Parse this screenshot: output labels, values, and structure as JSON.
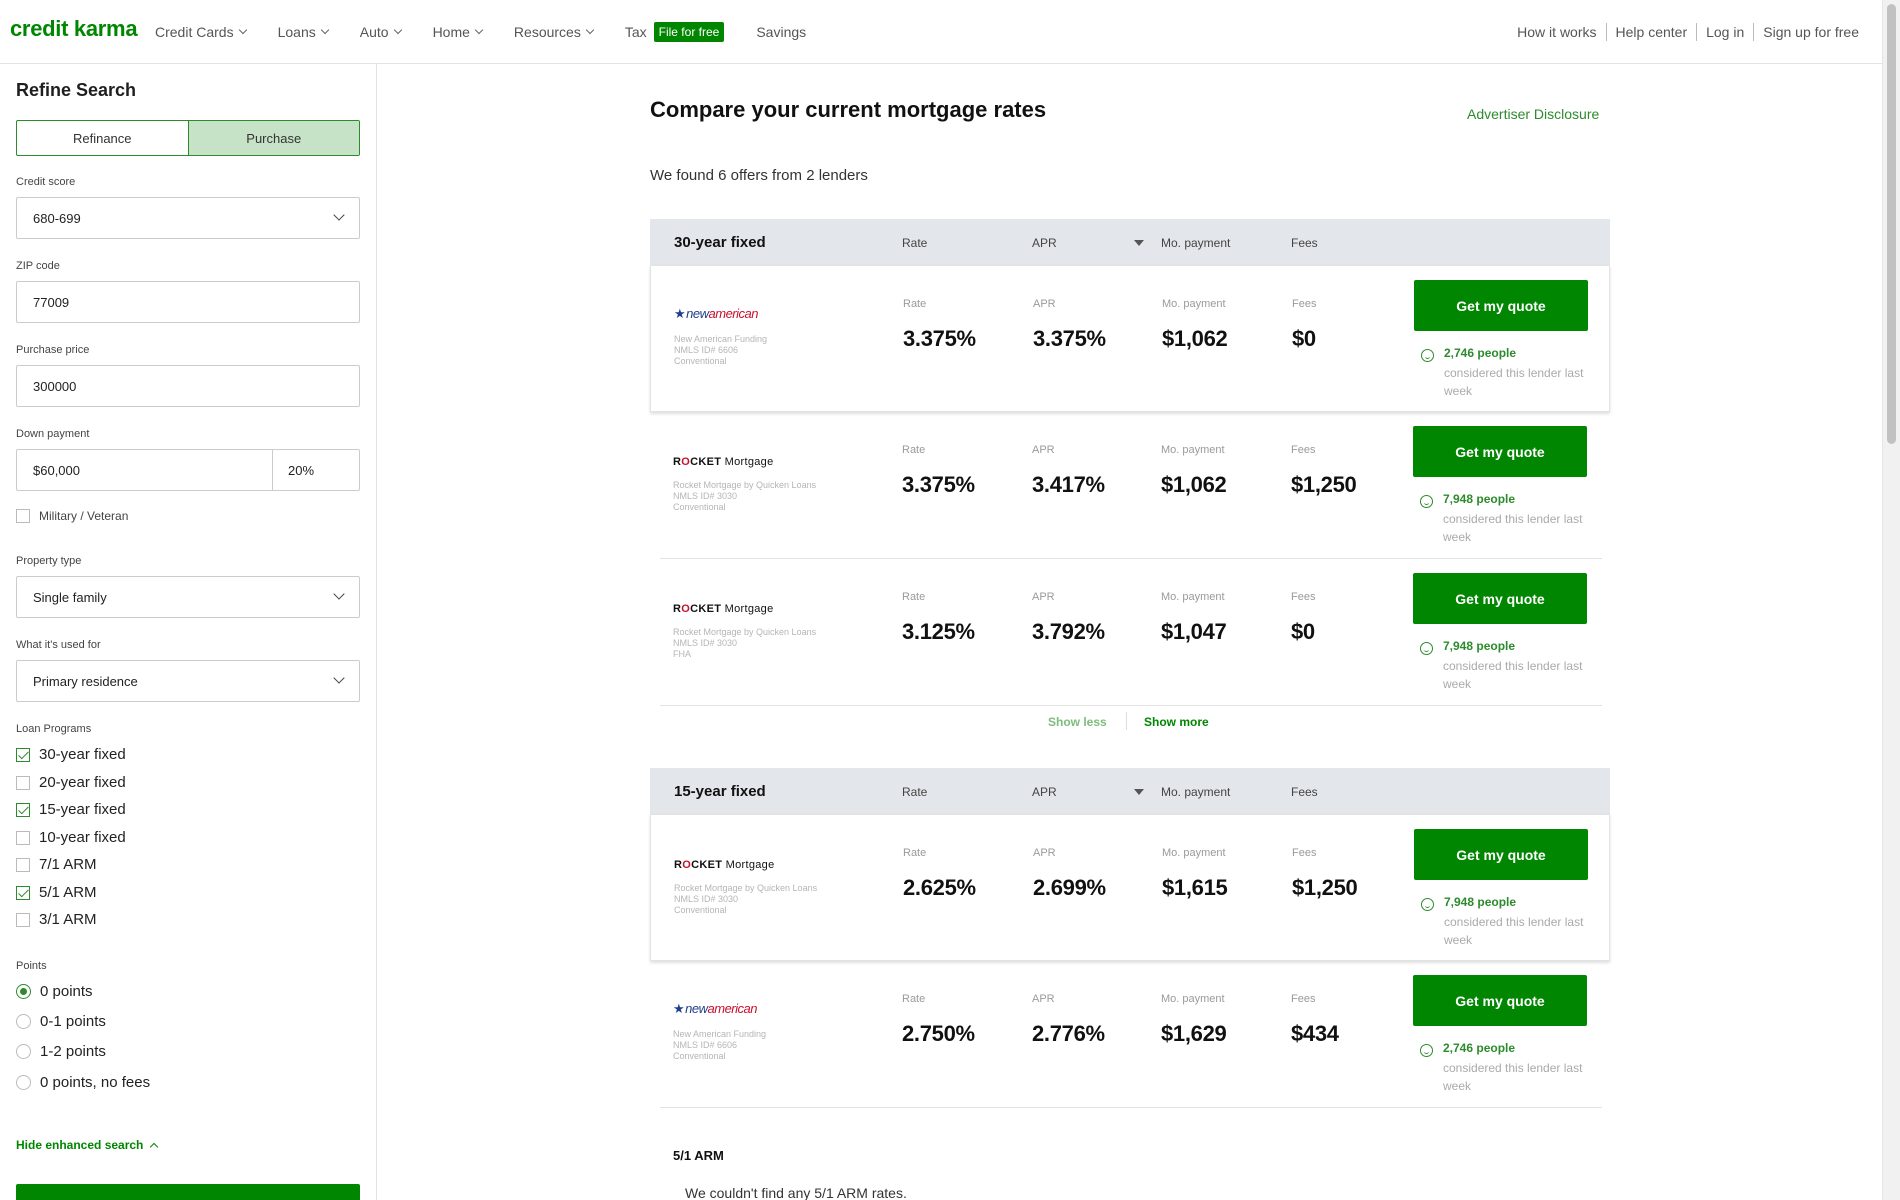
{
  "nav": {
    "logo": "credit karma",
    "items": [
      "Credit Cards",
      "Loans",
      "Auto",
      "Home",
      "Resources"
    ],
    "tax_label": "Tax",
    "tax_badge": "File for free",
    "savings": "Savings",
    "right": [
      "How it works",
      "Help center",
      "Log in",
      "Sign up for free"
    ]
  },
  "sidebar": {
    "title": "Refine Search",
    "seg": {
      "refinance": "Refinance",
      "purchase": "Purchase",
      "active": "purchase"
    },
    "credit_label": "Credit score",
    "credit_value": "680-699",
    "zip_label": "ZIP code",
    "zip_value": "77009",
    "price_label": "Purchase price",
    "price_value": "300000",
    "down_label": "Down payment",
    "down_value": "$60,000",
    "down_pct": "20%",
    "military": "Military / Veteran",
    "military_checked": false,
    "property_label": "Property type",
    "property_value": "Single family",
    "use_label": "What it's used for",
    "use_value": "Primary residence",
    "programs_label": "Loan Programs",
    "programs": [
      {
        "label": "30-year fixed",
        "checked": true
      },
      {
        "label": "20-year fixed",
        "checked": false
      },
      {
        "label": "15-year fixed",
        "checked": true
      },
      {
        "label": "10-year fixed",
        "checked": false
      },
      {
        "label": "7/1 ARM",
        "checked": false
      },
      {
        "label": "5/1 ARM",
        "checked": true
      },
      {
        "label": "3/1 ARM",
        "checked": false
      }
    ],
    "points_label": "Points",
    "points": [
      {
        "label": "0 points",
        "selected": true
      },
      {
        "label": "0-1 points",
        "selected": false
      },
      {
        "label": "1-2 points",
        "selected": false
      },
      {
        "label": "0 points, no fees",
        "selected": false
      }
    ],
    "hide_enhanced": "Hide enhanced search"
  },
  "main": {
    "title": "Compare your current mortgage rates",
    "disclosure": "Advertiser Disclosure",
    "found": "We found 6 offers from 2 lenders",
    "col_labels": {
      "rate": "Rate",
      "apr": "APR",
      "mo": "Mo. payment",
      "fees": "Fees"
    },
    "quote_label": "Get my quote",
    "considered": "considered this lender last week",
    "show_less": "Show less",
    "show_more": "Show more",
    "groups": [
      {
        "title": "30-year fixed",
        "offers": [
          {
            "lender": "newamerican",
            "meta": [
              "New American Funding",
              "NMLS ID# 6606",
              "Conventional"
            ],
            "rate": "3.375%",
            "apr": "3.375%",
            "mo": "$1,062",
            "fees": "$0",
            "people": "2,746 people"
          },
          {
            "lender": "rocket",
            "meta": [
              "Rocket Mortgage by Quicken Loans",
              "NMLS ID# 3030",
              "Conventional"
            ],
            "rate": "3.375%",
            "apr": "3.417%",
            "mo": "$1,062",
            "fees": "$1,250",
            "people": "7,948 people"
          },
          {
            "lender": "rocket",
            "meta": [
              "Rocket Mortgage by Quicken Loans",
              "NMLS ID# 3030",
              "FHA"
            ],
            "rate": "3.125%",
            "apr": "3.792%",
            "mo": "$1,047",
            "fees": "$0",
            "people": "7,948 people"
          }
        ]
      },
      {
        "title": "15-year fixed",
        "offers": [
          {
            "lender": "rocket",
            "meta": [
              "Rocket Mortgage by Quicken Loans",
              "NMLS ID# 3030",
              "Conventional"
            ],
            "rate": "2.625%",
            "apr": "2.699%",
            "mo": "$1,615",
            "fees": "$1,250",
            "people": "7,948 people"
          },
          {
            "lender": "newamerican",
            "meta": [
              "New American Funding",
              "NMLS ID# 6606",
              "Conventional"
            ],
            "rate": "2.750%",
            "apr": "2.776%",
            "mo": "$1,629",
            "fees": "$434",
            "people": "2,746 people"
          }
        ]
      }
    ],
    "arm_title": "5/1 ARM",
    "arm_msg": "We couldn't find any 5/1 ARM rates."
  },
  "logos": {
    "newamerican": {
      "mark": "★",
      "text_a": "new",
      "text_b": "american"
    },
    "rocket": {
      "r": "R",
      "o": "O",
      "rest": "CKET",
      "m": " Mortgage"
    }
  },
  "colors": {
    "brand": "#008600",
    "header_bg": "#e3e6ea"
  }
}
